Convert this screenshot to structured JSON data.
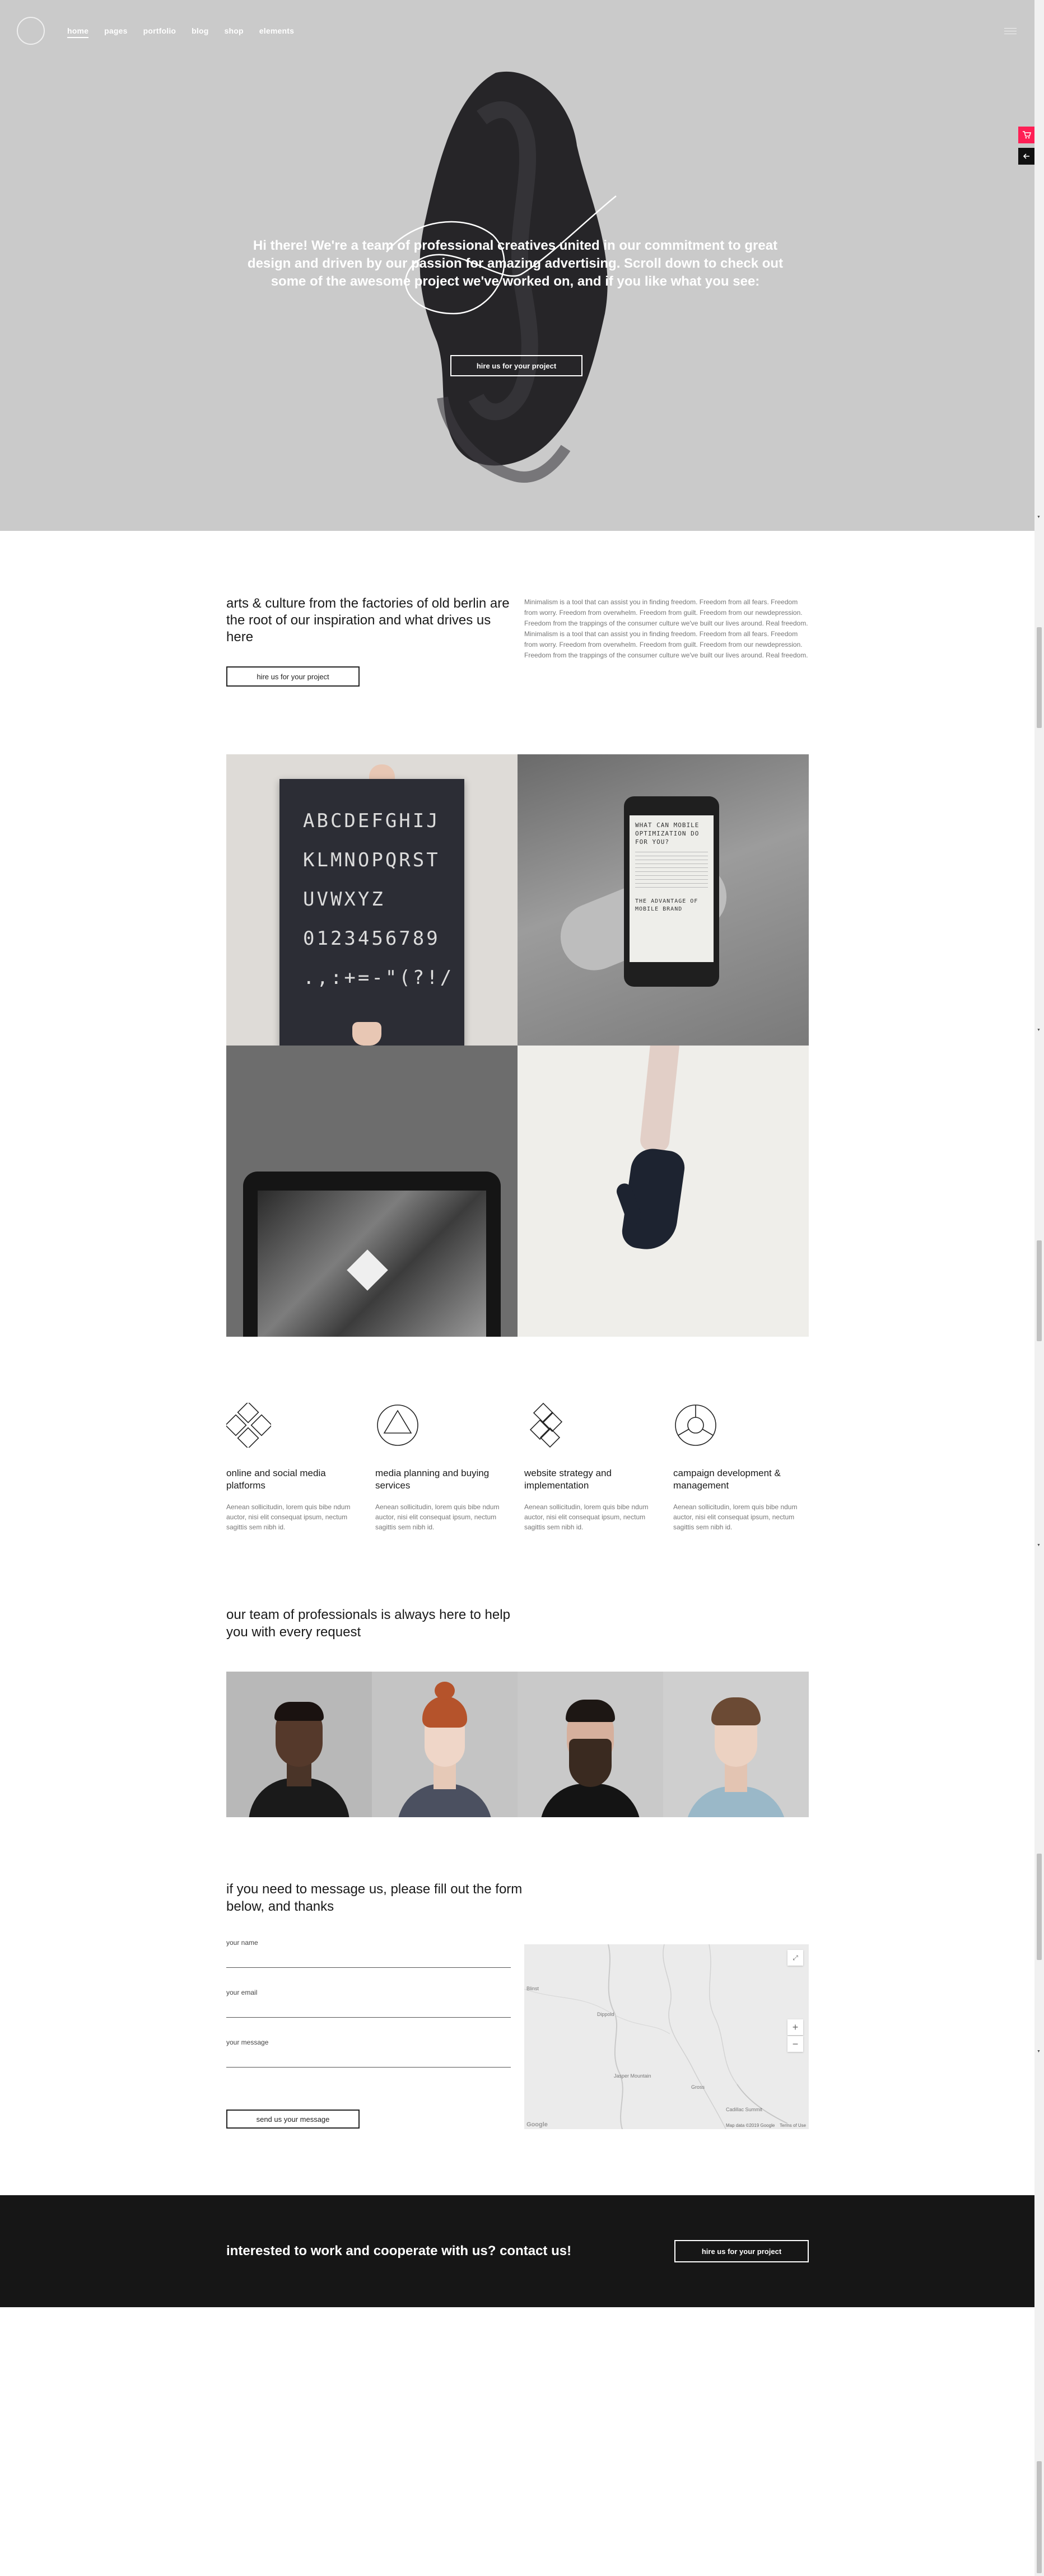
{
  "nav": {
    "items": [
      {
        "label": "home",
        "active": true
      },
      {
        "label": "pages"
      },
      {
        "label": "portfolio"
      },
      {
        "label": "blog"
      },
      {
        "label": "shop"
      },
      {
        "label": "elements"
      }
    ]
  },
  "hero": {
    "text": "Hi there! We're a team of professional creatives united in our commitment to great design and driven by our passion for amazing advertising. Scroll down to check out some of the awesome project we've worked on, and if you like what you see:",
    "button": "hire us for your project"
  },
  "side": {
    "cart_icon": "cart-icon",
    "arrow_icon": "arrow-left-icon",
    "accent": "#ff1f55"
  },
  "intro": {
    "heading": "arts & culture from the factories of old berlin are the root of our inspiration and what drives us here",
    "button": "hire us for your project",
    "text": "Minimalism is a tool that can assist you in finding freedom. Freedom from all fears. Freedom from worry. Freedom from overwhelm. Freedom from guilt. Freedom from our newdepression. Freedom from the trappings of the consumer culture we've built our lives around. Real freedom. Minimalism is a tool that can assist you in finding freedom. Freedom from all fears. Freedom from worry. Freedom from overwhelm. Freedom from guilt. Freedom from our newdepression. Freedom from the trappings of the consumer culture we've built our lives around. Real freedom."
  },
  "gallery": {
    "poster_rows": [
      "ABCDEFGHIJ",
      "KLMNOPQRST",
      "UVWXYZ",
      "0123456789",
      ".,:+=-\"(?!/"
    ],
    "phone_title": "WHAT CAN MOBILE OPTIMIZATION DO FOR YOU?",
    "phone_sub": "THE ADVANTAGE OF MOBILE BRAND"
  },
  "services": [
    {
      "icon": "diamond-grid-icon",
      "title": "online and social media platforms",
      "text": "Aenean sollicitudin, lorem quis bibe ndum auctor, nisi elit consequat ipsum, nectum sagittis sem nibh id."
    },
    {
      "icon": "circle-triangle-icon",
      "title": "media planning and buying services",
      "text": "Aenean sollicitudin, lorem quis bibe ndum auctor, nisi elit consequat ipsum, nectum sagittis sem nibh id."
    },
    {
      "icon": "diamond-cluster-icon",
      "title": "website strategy and implementation",
      "text": "Aenean sollicitudin, lorem quis bibe ndum auctor, nisi elit consequat ipsum, nectum sagittis sem nibh id."
    },
    {
      "icon": "circle-segments-icon",
      "title": "campaign development & management",
      "text": "Aenean sollicitudin, lorem quis bibe ndum auctor, nisi elit consequat ipsum, nectum sagittis sem nibh id."
    }
  ],
  "team": {
    "heading": "our team of professionals is always here to help you with every request"
  },
  "contact": {
    "heading": "if you need to message us, please fill out the form below, and thanks",
    "name_label": "your name",
    "email_label": "your email",
    "message_label": "your message",
    "submit": "send us your message",
    "map": {
      "labels": [
        "Blinst",
        "Dippold",
        "Jasper Mountain",
        "Gross",
        "Cadillac Summit"
      ],
      "attribution": "Map data ©2019 Google",
      "terms": "Terms of Use",
      "provider": "Google"
    }
  },
  "cta": {
    "text": "interested to work and cooperate with us? contact us!",
    "button": "hire us for your project"
  }
}
